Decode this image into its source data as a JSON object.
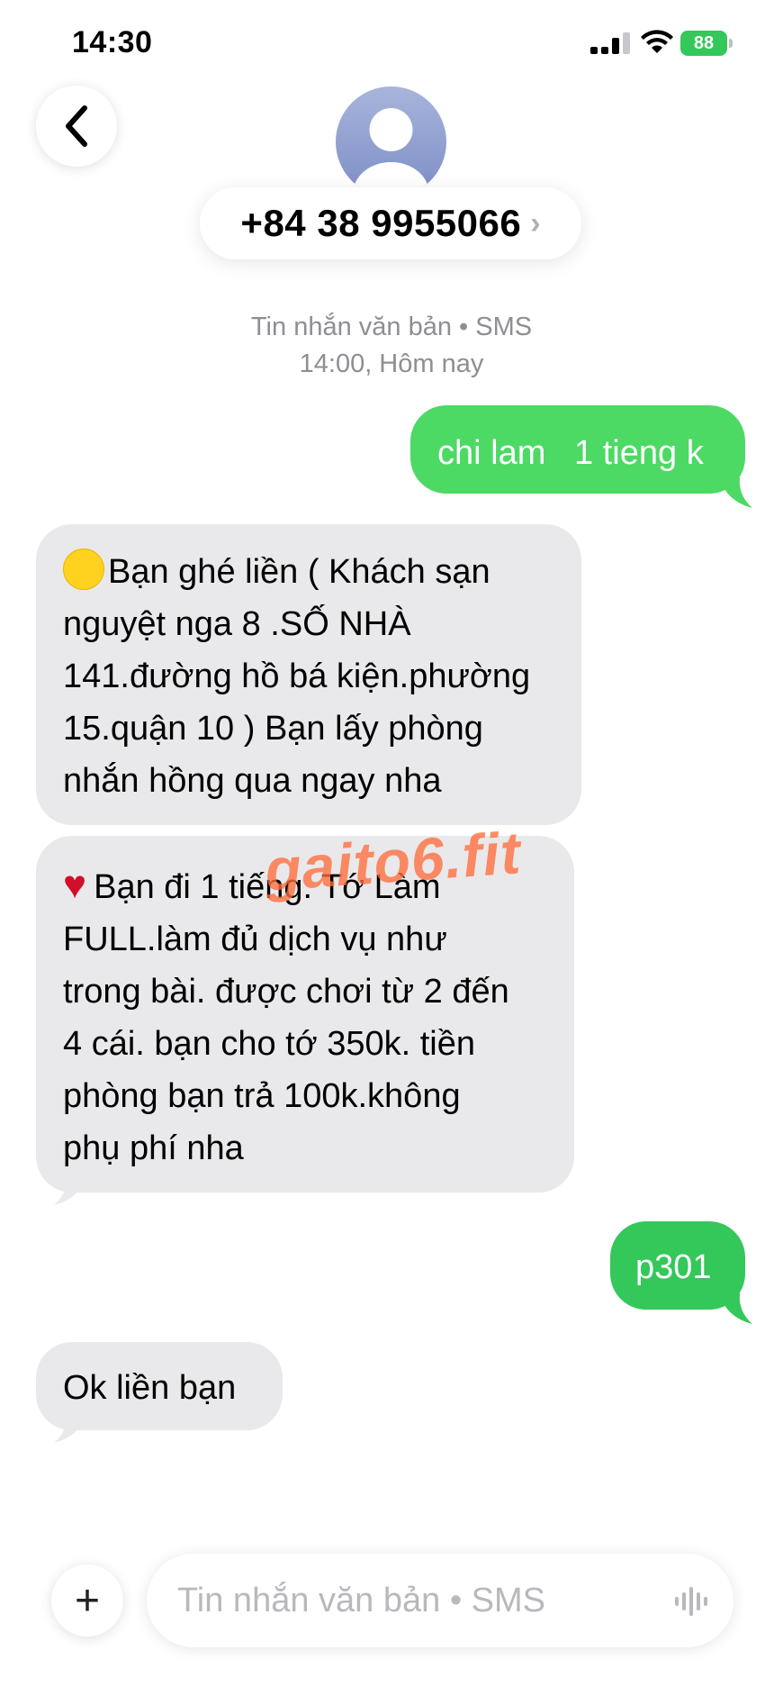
{
  "status_bar": {
    "time": "14:30",
    "battery": "88"
  },
  "header": {
    "contact": "+84 38 9955066",
    "chevron": "›",
    "service_line": "Tin nhắn văn bản • SMS",
    "timestamp": "14:00, Hôm nay"
  },
  "messages": [
    {
      "direction": "outgoing",
      "text": "chi lam   1 tieng k"
    },
    {
      "direction": "incoming",
      "lines": [
        "Bạn  ghé liền ( Khách sạn",
        "nguyệt nga 8 .SỐ NHÀ",
        "141.đường hồ bá kiện.phường",
        "15.quận 10 ) Bạn  lấy phòng",
        "nhắn hồng qua ngay nha"
      ]
    },
    {
      "direction": "incoming",
      "lines": [
        "Bạn đi 1 tiếng. Tớ Làm",
        "FULL.làm đủ dịch vụ như",
        "trong bài. được chơi từ 2 đến",
        "4 cái. bạn cho tớ 350k. tiền",
        "phòng bạn trả 100k.không",
        "phụ phí nha"
      ]
    },
    {
      "direction": "outgoing",
      "text": "p301"
    },
    {
      "direction": "incoming",
      "text": "Ok liền bạn"
    }
  ],
  "watermark": "gaito6.fit",
  "composer": {
    "placeholder": "Tin nhắn văn bản • SMS",
    "plus": "+"
  },
  "icons": [
    "chevron-left-icon",
    "avatar-icon",
    "signal-icon",
    "wifi-icon",
    "battery-icon",
    "plus-icon",
    "mic-waveform-icon"
  ],
  "colors": {
    "outgoing_bubble": "#4cd964",
    "incoming_bubble": "#e9e9eb",
    "meta_text": "#8e8e93"
  }
}
